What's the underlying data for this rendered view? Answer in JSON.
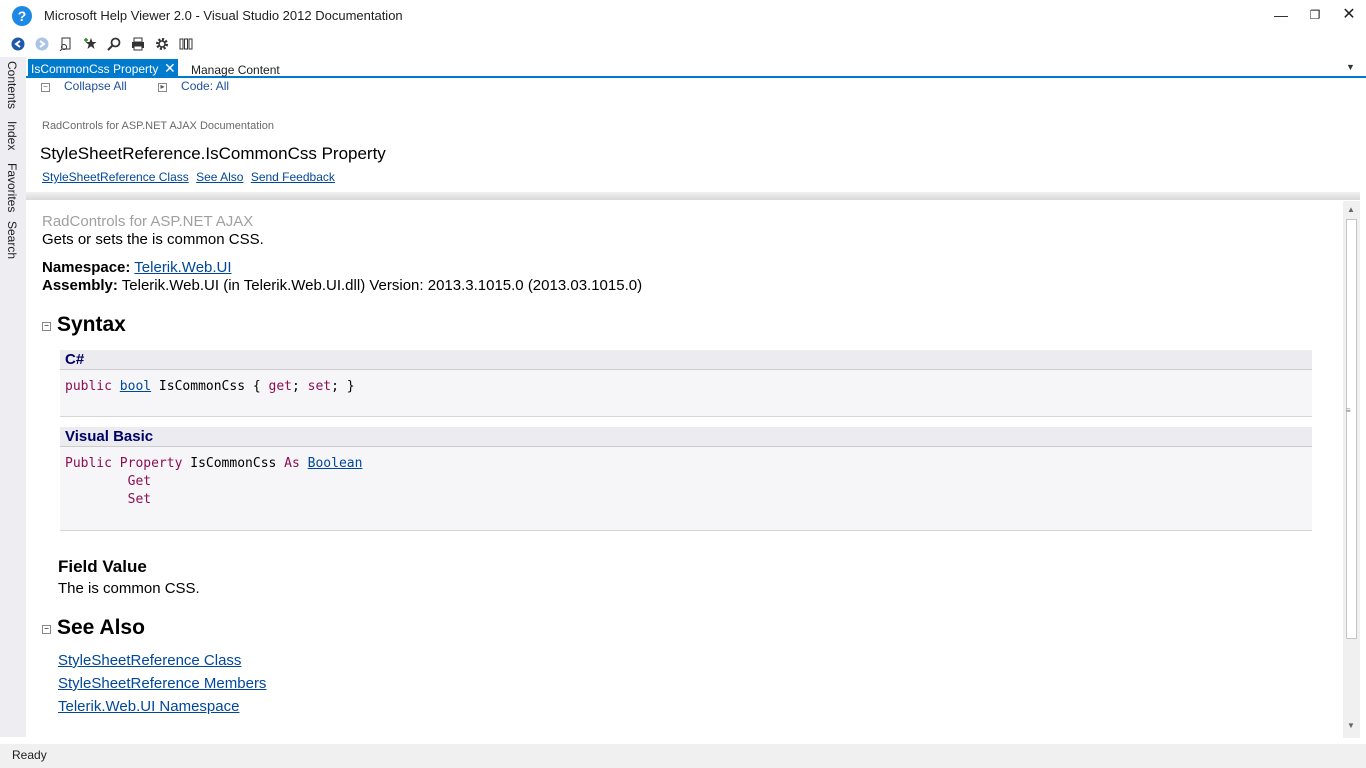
{
  "window": {
    "title": "Microsoft Help Viewer 2.0 - Visual Studio 2012 Documentation",
    "minimize_label": "—",
    "maximize_label": "❐",
    "close_label": "✕"
  },
  "toolbar": {
    "icons": [
      "back-icon",
      "forward-icon",
      "find-in-topic-icon",
      "add-favorite-icon",
      "search-icon",
      "print-icon",
      "settings-icon",
      "manage-content-icon"
    ]
  },
  "side_tabs": [
    "Contents",
    "Index",
    "Favorites",
    "Search"
  ],
  "tabs": {
    "active": "IsCommonCss Property",
    "other": "Manage Content"
  },
  "header": {
    "collapse_all": "Collapse All",
    "code_all": "Code: All",
    "breadcrumb": "RadControls for ASP.NET AJAX Documentation",
    "title": "StyleSheetReference.IsCommonCss Property",
    "links": [
      "StyleSheetReference Class",
      "See Also",
      "Send Feedback"
    ]
  },
  "body": {
    "product": "RadControls for ASP.NET AJAX",
    "summary": "Gets or sets the is common CSS.",
    "namespace_label": "Namespace:",
    "namespace_value": "Telerik.Web.UI",
    "assembly_label": "Assembly:",
    "assembly_value": "Telerik.Web.UI (in Telerik.Web.UI.dll) Version: 2013.3.1015.0 (2013.03.1015.0)",
    "syntax_heading": "Syntax",
    "csharp": {
      "lang": "C#",
      "kw_public": "public",
      "type": "bool",
      "rest": " IsCommonCss { ",
      "get": "get",
      "semi1": "; ",
      "set": "set",
      "end": "; }"
    },
    "vb": {
      "lang": "Visual Basic",
      "kw_public": "Public",
      "kw_property": "Property",
      "name": " IsCommonCss ",
      "kw_as": "As",
      "type": "Boolean",
      "get": "Get",
      "set": "Set"
    },
    "field_value_heading": "Field Value",
    "field_value_text": "The is common CSS.",
    "see_also_heading": "See Also",
    "see_also_links": [
      "StyleSheetReference Class",
      "StyleSheetReference Members",
      "Telerik.Web.UI Namespace"
    ]
  },
  "status": "Ready"
}
